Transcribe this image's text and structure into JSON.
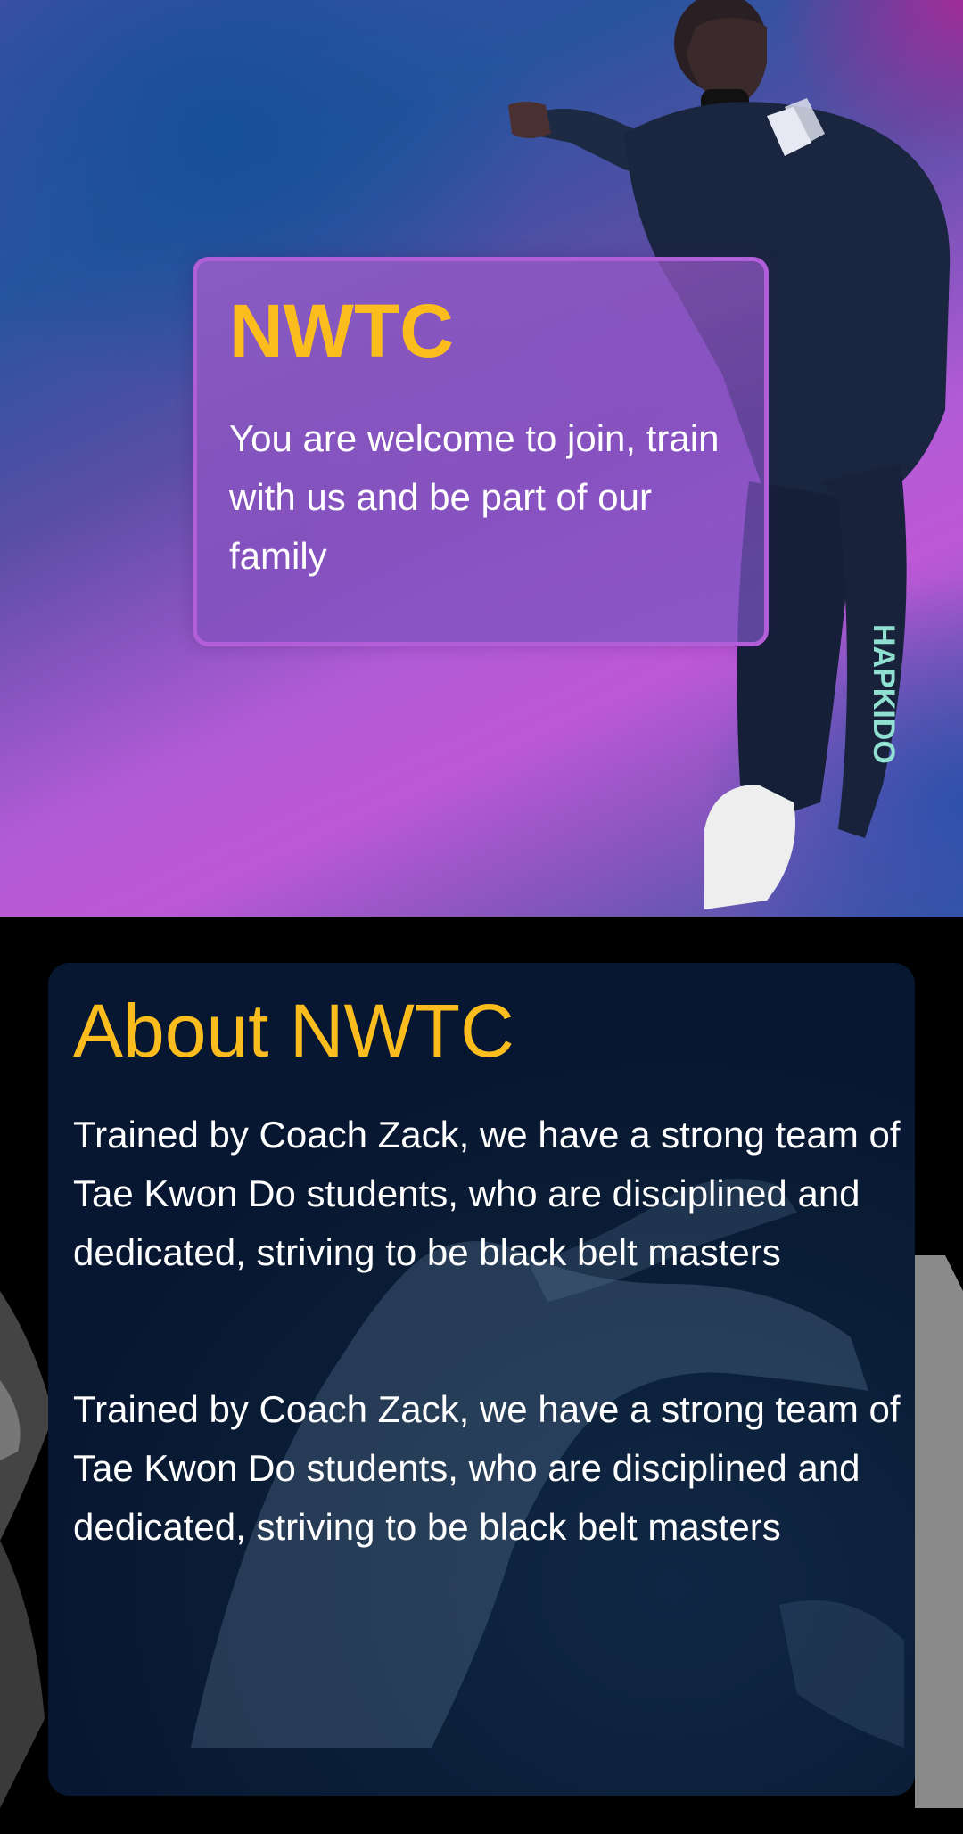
{
  "hero": {
    "title": "NWTC",
    "text": "You are welcome to join, train with us and be part of our family"
  },
  "about": {
    "title": "About NWTC",
    "paragraphs": [
      "Trained by Coach Zack, we have a strong team of Tae Kwon Do students, who are disciplined and dedicated, striving to be black belt masters",
      "Trained by Coach Zack, we have a strong team of Tae Kwon Do students, who are disciplined and dedicated, striving to be black belt masters"
    ]
  },
  "colors": {
    "accent": "#fbbd1e",
    "hero_card_border": "#b25ed8",
    "about_card_bg": "#0a1c35",
    "text": "#ffffff"
  }
}
